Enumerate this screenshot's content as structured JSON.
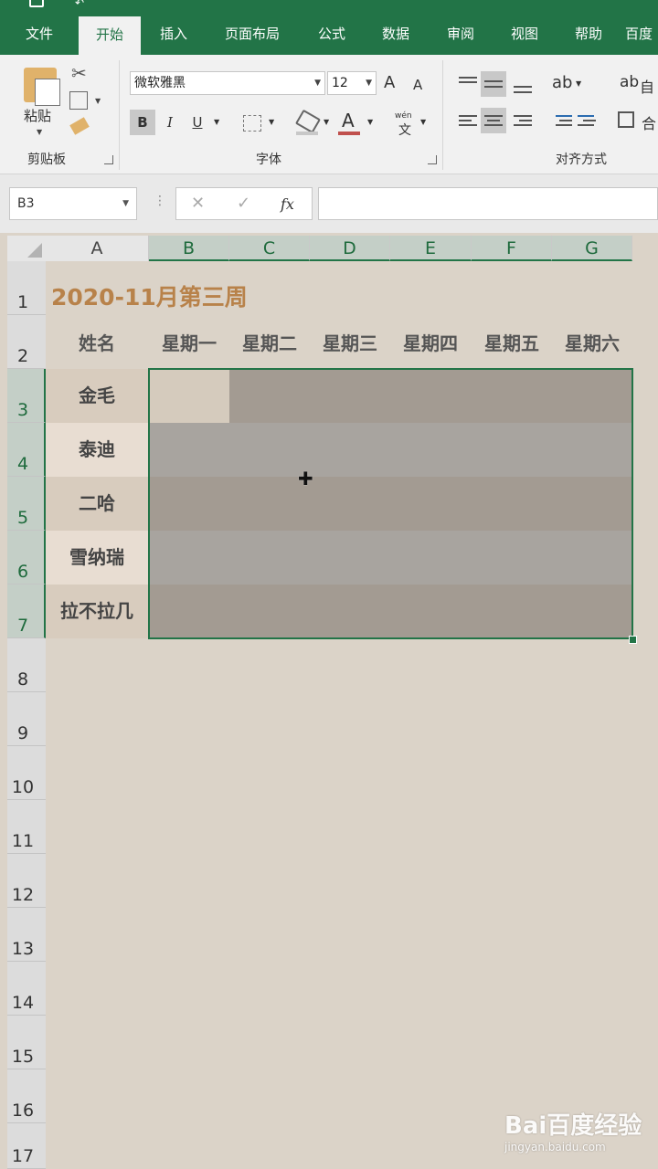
{
  "ribbon_tabs": [
    "文件",
    "开始",
    "插入",
    "页面布局",
    "公式",
    "数据",
    "审阅",
    "视图",
    "帮助",
    "百度"
  ],
  "active_tab": "开始",
  "clipboard": {
    "paste_label": "粘贴",
    "group_label": "剪贴板"
  },
  "font": {
    "name": "微软雅黑",
    "size": "12",
    "group_label": "字体",
    "bold": "B",
    "italic": "I",
    "underline": "U",
    "grow": "A",
    "shrink": "A",
    "font_color": "A",
    "phonetic_top": "wén",
    "phonetic_bottom": "文"
  },
  "alignment": {
    "group_label": "对齐方式",
    "wrap_partial": "自",
    "merge_partial": "合"
  },
  "formula_bar": {
    "name_box": "B3",
    "fx": "fx",
    "value": ""
  },
  "columns": [
    "A",
    "B",
    "C",
    "D",
    "E",
    "F",
    "G"
  ],
  "selected_columns": [
    "B",
    "C",
    "D",
    "E",
    "F",
    "G"
  ],
  "rows": [
    "1",
    "2",
    "3",
    "4",
    "5",
    "6",
    "7",
    "8",
    "9",
    "10",
    "11",
    "12",
    "13",
    "14",
    "15",
    "16",
    "17"
  ],
  "selected_rows": [
    "3",
    "4",
    "5",
    "6",
    "7"
  ],
  "sheet": {
    "title": "2020-11月第三周",
    "header_name": "姓名",
    "days": [
      "星期一",
      "星期二",
      "星期三",
      "星期四",
      "星期五",
      "星期六"
    ],
    "names": [
      "金毛",
      "泰迪",
      "二哈",
      "雪纳瑞",
      "拉不拉几"
    ]
  },
  "selection": {
    "range": "B3:G7",
    "active_cell": "B3"
  },
  "colors": {
    "accent": "#227447",
    "title_text": "#b8824a",
    "sheet_bg": "#dbd3c8",
    "name_band_light": "#e8ddd2",
    "name_band_dark": "#d8ccbe",
    "selection_dark": "#a39b92",
    "selection_light": "#a8a49f"
  },
  "watermark": {
    "logo": "Bai百度经验",
    "url": "jingyan.baidu.com"
  }
}
